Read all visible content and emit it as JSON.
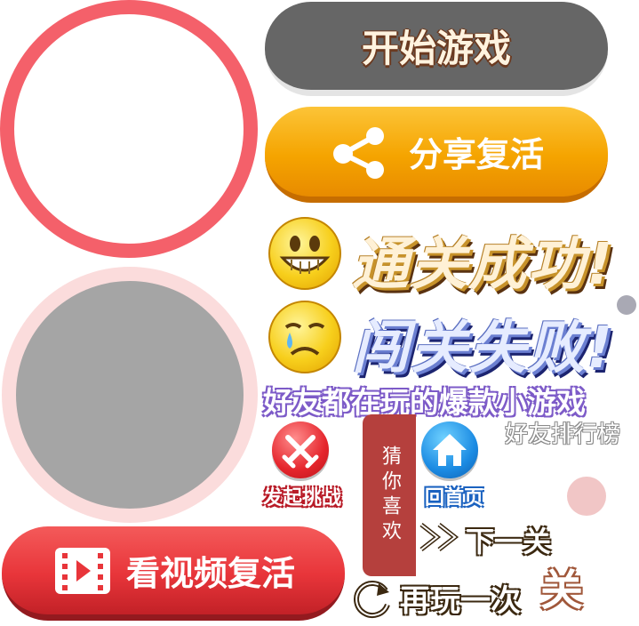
{
  "buttons": {
    "start_game": "开始游戏",
    "share_revive": "分享复活",
    "video_revive": "看视频复活"
  },
  "result": {
    "win": "通关成功!",
    "lose": "闯关失败!"
  },
  "friends": {
    "title": "好友都在玩的爆款小游戏",
    "rank": "好友排行榜"
  },
  "actions": {
    "challenge": "发起挑战",
    "home": "回首页",
    "guess": "猜你喜欢",
    "next_level": "下一关",
    "replay": "再玩一次",
    "close": "关"
  },
  "colors": {
    "ring_red": "#f4606a",
    "share_orange": "#f5a400",
    "video_red": "#e8353a",
    "start_gray": "#666666"
  },
  "icons": [
    "share-icon",
    "video-icon",
    "smile-icon",
    "sad-icon",
    "swords-icon",
    "home-icon",
    "next-arrow-icon",
    "replay-icon"
  ]
}
